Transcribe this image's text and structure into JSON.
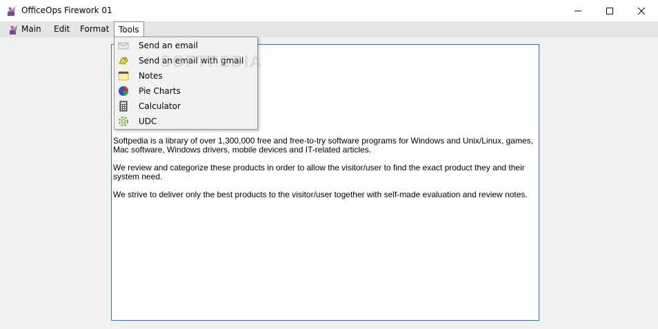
{
  "window": {
    "title": "OfficeOps Firework 01",
    "icon": "firework-app-icon",
    "controls": [
      "minimize-icon",
      "maximize-icon",
      "close-icon"
    ]
  },
  "menubar": {
    "items": [
      {
        "label": "Main",
        "icon": "firework-icon"
      },
      {
        "label": "Edit"
      },
      {
        "label": "Format"
      },
      {
        "label": "Tools",
        "active": true
      }
    ]
  },
  "tools_menu": {
    "items": [
      {
        "label": "Send an email",
        "icon": "email-icon"
      },
      {
        "label": "Send an email with gmail",
        "icon": "gmail-icon"
      },
      {
        "label": "Notes",
        "icon": "notes-icon"
      },
      {
        "label": "Pie Charts",
        "icon": "pie-chart-icon"
      },
      {
        "label": "Calculator",
        "icon": "calculator-icon"
      },
      {
        "label": "UDC",
        "icon": "udc-icon"
      }
    ]
  },
  "document": {
    "paragraphs": [
      "Softpedia is a library of over 1,300,000 free and free-to-try software programs for Windows and Unix/Linux, games, Mac software, Windows drivers, mobile devices and IT-related articles.",
      "We review and categorize these products in order to allow the visitor/user to find the exact product they and their system need.",
      "We strive to deliver only the best products to the visitor/user together with self-made evaluation and review notes."
    ]
  },
  "watermark": "SOFTPEDIA",
  "colors": {
    "accent_border": "#2f6ec4",
    "menubar_bg": "#e5e5e5",
    "menu_bg": "#f2f2f2"
  }
}
